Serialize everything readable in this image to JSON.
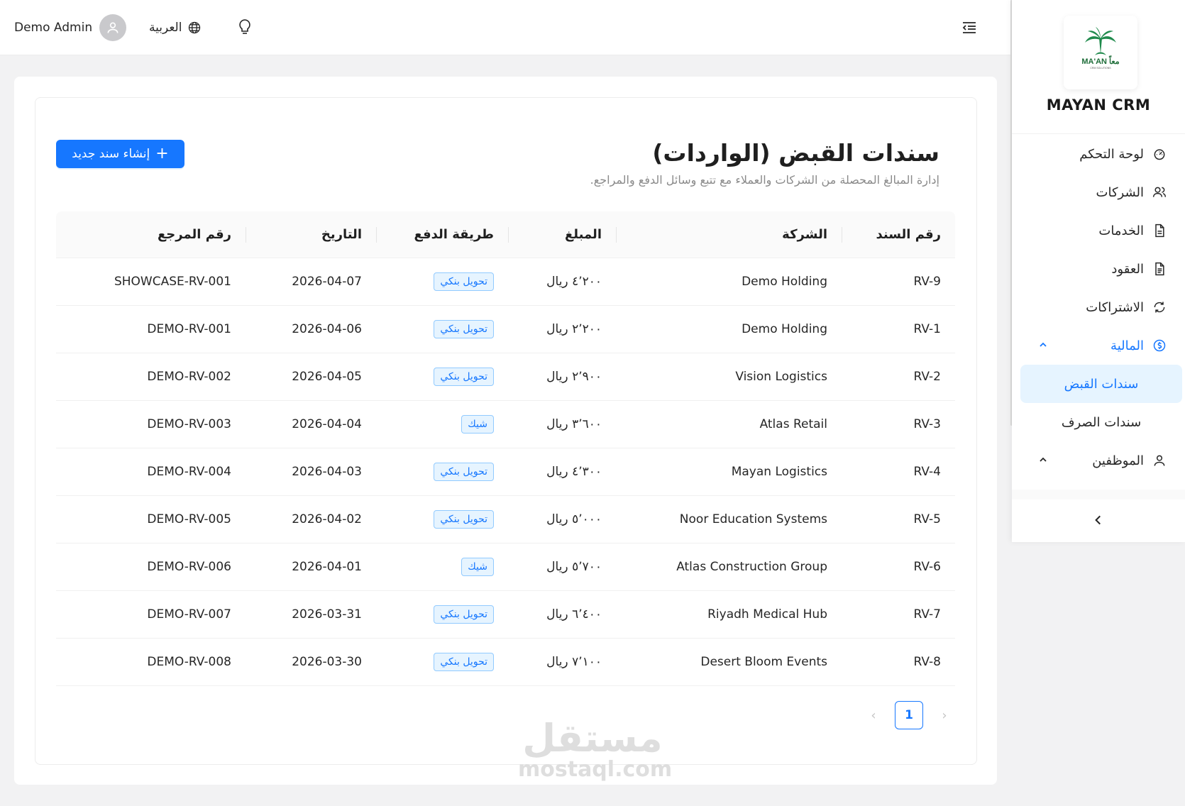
{
  "header": {
    "user_name": "Demo Admin",
    "language_label": "العربية",
    "icons": [
      "user-icon",
      "globe-icon",
      "bulb-icon",
      "menu-fold-icon"
    ]
  },
  "sidebar": {
    "brand": "MAYAN CRM",
    "logo_text": "MA'AN معاً",
    "logo_subtext": "CRM SOLUTIONS",
    "items": [
      {
        "label": "لوحة التحكم",
        "icon": "dashboard-icon"
      },
      {
        "label": "الشركات",
        "icon": "team-icon"
      },
      {
        "label": "الخدمات",
        "icon": "file-icon"
      },
      {
        "label": "العقود",
        "icon": "file-text-icon"
      },
      {
        "label": "الاشتراكات",
        "icon": "sync-icon"
      },
      {
        "label": "المالية",
        "icon": "dollar-icon",
        "active": true,
        "expanded": true
      },
      {
        "label": "الموظفين",
        "icon": "user-icon",
        "expanded": true
      }
    ],
    "finance_sub": [
      {
        "label": "سندات القبض",
        "active": true
      },
      {
        "label": "سندات الصرف",
        "active": false
      }
    ]
  },
  "page": {
    "title": "سندات القبض (الواردات)",
    "subtitle": "إدارة المبالغ المحصلة من الشركات والعملاء مع تتبع وسائل الدفع والمراجع.",
    "create_button": "إنشاء سند جديد"
  },
  "table": {
    "headers": {
      "id": "رقم السند",
      "company": "الشركة",
      "amount": "المبلغ",
      "method": "طريقة الدفع",
      "date": "التاريخ",
      "ref": "رقم المرجع"
    },
    "rows": [
      {
        "id": "RV-9",
        "company": "Demo Holding",
        "amount": "٤٬٢٠٠ ريال",
        "method": "تحويل بنكي",
        "date": "2026-04-07",
        "ref": "SHOWCASE-RV-001"
      },
      {
        "id": "RV-1",
        "company": "Demo Holding",
        "amount": "٢٬٢٠٠ ريال",
        "method": "تحويل بنكي",
        "date": "2026-04-06",
        "ref": "DEMO-RV-001"
      },
      {
        "id": "RV-2",
        "company": "Vision Logistics",
        "amount": "٢٬٩٠٠ ريال",
        "method": "تحويل بنكي",
        "date": "2026-04-05",
        "ref": "DEMO-RV-002"
      },
      {
        "id": "RV-3",
        "company": "Atlas Retail",
        "amount": "٣٬٦٠٠ ريال",
        "method": "شيك",
        "date": "2026-04-04",
        "ref": "DEMO-RV-003"
      },
      {
        "id": "RV-4",
        "company": "Mayan Logistics",
        "amount": "٤٬٣٠٠ ريال",
        "method": "تحويل بنكي",
        "date": "2026-04-03",
        "ref": "DEMO-RV-004"
      },
      {
        "id": "RV-5",
        "company": "Noor Education Systems",
        "amount": "٥٬٠٠٠ ريال",
        "method": "تحويل بنكي",
        "date": "2026-04-02",
        "ref": "DEMO-RV-005"
      },
      {
        "id": "RV-6",
        "company": "Atlas Construction Group",
        "amount": "٥٬٧٠٠ ريال",
        "method": "شيك",
        "date": "2026-04-01",
        "ref": "DEMO-RV-006"
      },
      {
        "id": "RV-7",
        "company": "Riyadh Medical Hub",
        "amount": "٦٬٤٠٠ ريال",
        "method": "تحويل بنكي",
        "date": "2026-03-31",
        "ref": "DEMO-RV-007"
      },
      {
        "id": "RV-8",
        "company": "Desert Bloom Events",
        "amount": "٧٬١٠٠ ريال",
        "method": "تحويل بنكي",
        "date": "2026-03-30",
        "ref": "DEMO-RV-008"
      }
    ]
  },
  "pagination": {
    "current": "1",
    "prev": "‹",
    "next": "›"
  },
  "watermark": {
    "arabic": "مستقل",
    "latin": "mostaql.com"
  },
  "colors": {
    "accent": "#1677ff",
    "tag_bg": "#e6f4ff",
    "tag_border": "#91caff",
    "page_bg": "#f2f2f3",
    "logo_green": "#1f8a4c"
  }
}
